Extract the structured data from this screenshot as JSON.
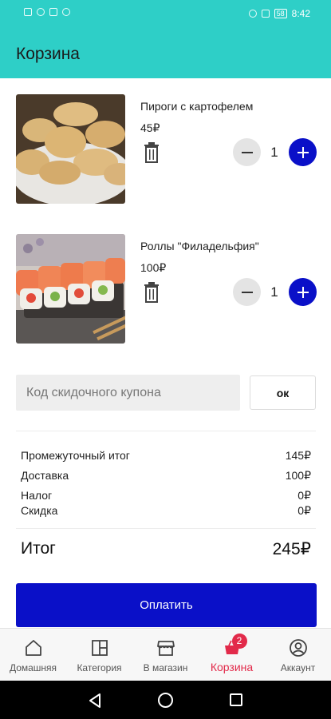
{
  "status": {
    "time": "8:42",
    "battery": "58"
  },
  "header": {
    "title": "Корзина"
  },
  "cart": {
    "items": [
      {
        "name": "Пироги с картофелем",
        "price": "45₽",
        "qty": "1"
      },
      {
        "name": "Роллы \"Филадельфия\"",
        "price": "100₽",
        "qty": "1"
      }
    ]
  },
  "coupon": {
    "placeholder": "Код скидочного купона",
    "button": "ок"
  },
  "summary": {
    "subtotal_label": "Промежуточный итог",
    "subtotal_value": "145₽",
    "delivery_label": "Доставка",
    "delivery_value": "100₽",
    "tax_label": "Налог",
    "tax_value": "0₽",
    "discount_label": "Скидка",
    "discount_value": "0₽",
    "total_label": "Итог",
    "total_value": "245₽"
  },
  "pay": {
    "label": "Оплатить"
  },
  "nav": {
    "items": [
      {
        "label": "Домашняя",
        "icon": "home-icon"
      },
      {
        "label": "Категория",
        "icon": "category-icon"
      },
      {
        "label": "В магазин",
        "icon": "store-icon"
      },
      {
        "label": "Корзина",
        "icon": "basket-icon",
        "badge": "2"
      },
      {
        "label": "Аккаунт",
        "icon": "account-icon"
      }
    ]
  },
  "colors": {
    "accent": "#2ecfc7",
    "primary": "#0a10c8",
    "active": "#e22a4a"
  }
}
